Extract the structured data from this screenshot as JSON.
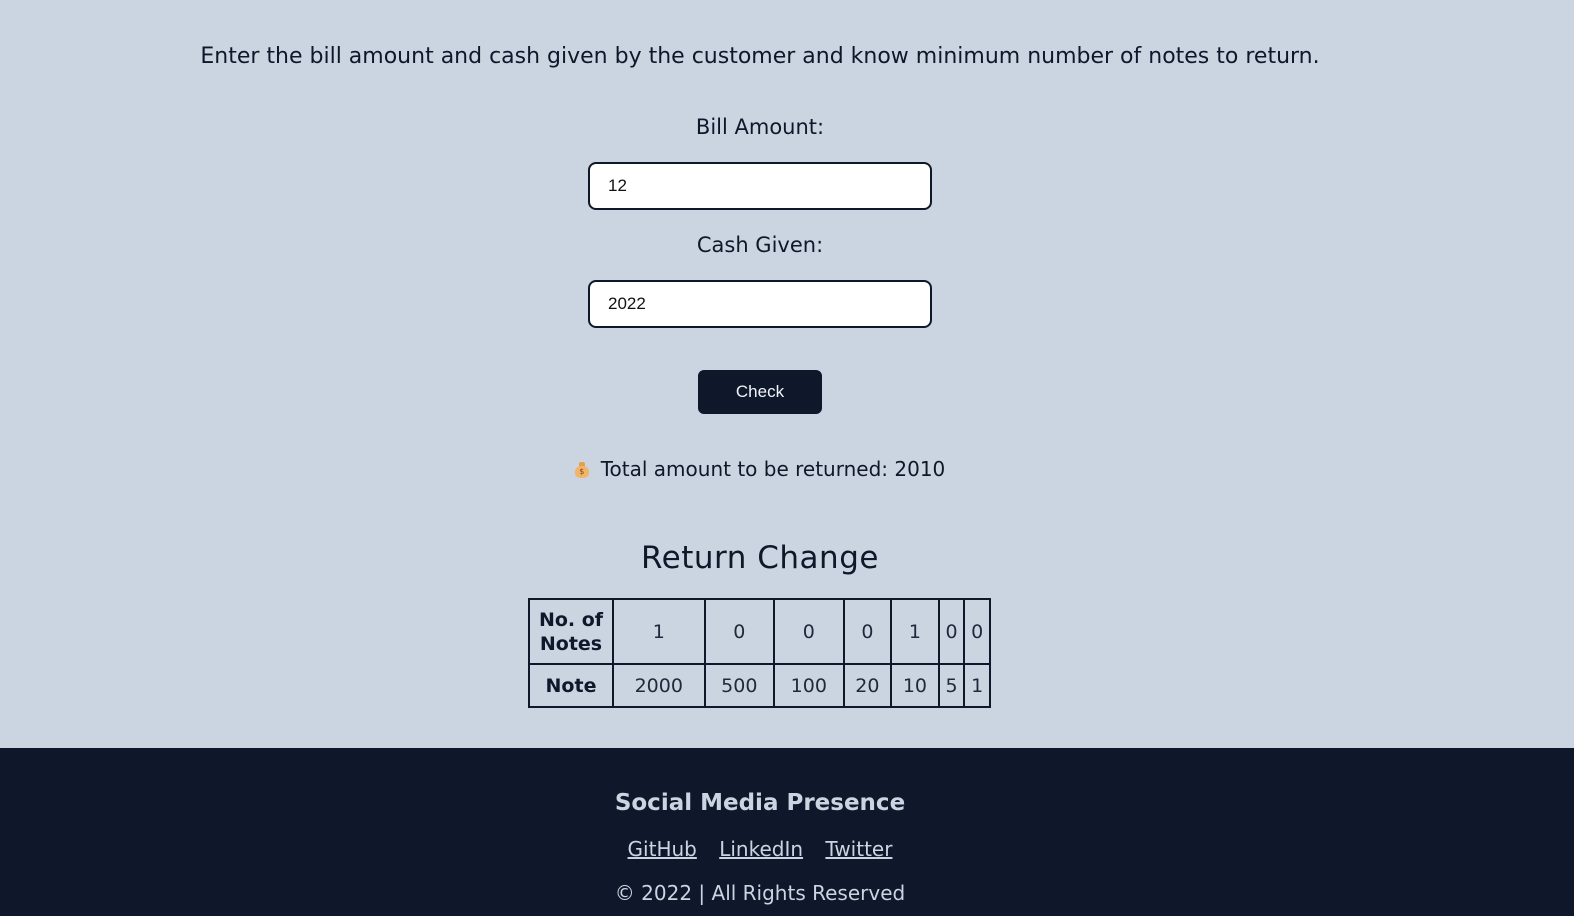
{
  "intro": {
    "text": "Enter the bill amount and cash given by the customer and know minimum number of notes to return."
  },
  "form": {
    "bill_label": "Bill Amount:",
    "bill_value": "12",
    "cash_label": "Cash Given:",
    "cash_value": "2022",
    "check_label": "Check"
  },
  "result": {
    "icon": "moneybag-icon",
    "text": "Total amount to be returned: 2010"
  },
  "change": {
    "heading": "Return Change",
    "count_header": "No. of Notes",
    "note_header": "Note",
    "counts": [
      "1",
      "0",
      "0",
      "0",
      "1",
      "0",
      "0"
    ],
    "notes": [
      "2000",
      "500",
      "100",
      "20",
      "10",
      "5",
      "1"
    ]
  },
  "footer": {
    "title": "Social Media Presence",
    "links": [
      "GitHub",
      "LinkedIn",
      "Twitter"
    ],
    "copyright": "© 2022 | All Rights Reserved"
  },
  "colors": {
    "page_background": "#cbd5e1",
    "primary_dark": "#0f172a",
    "footer_text": "#cbd5e1"
  }
}
